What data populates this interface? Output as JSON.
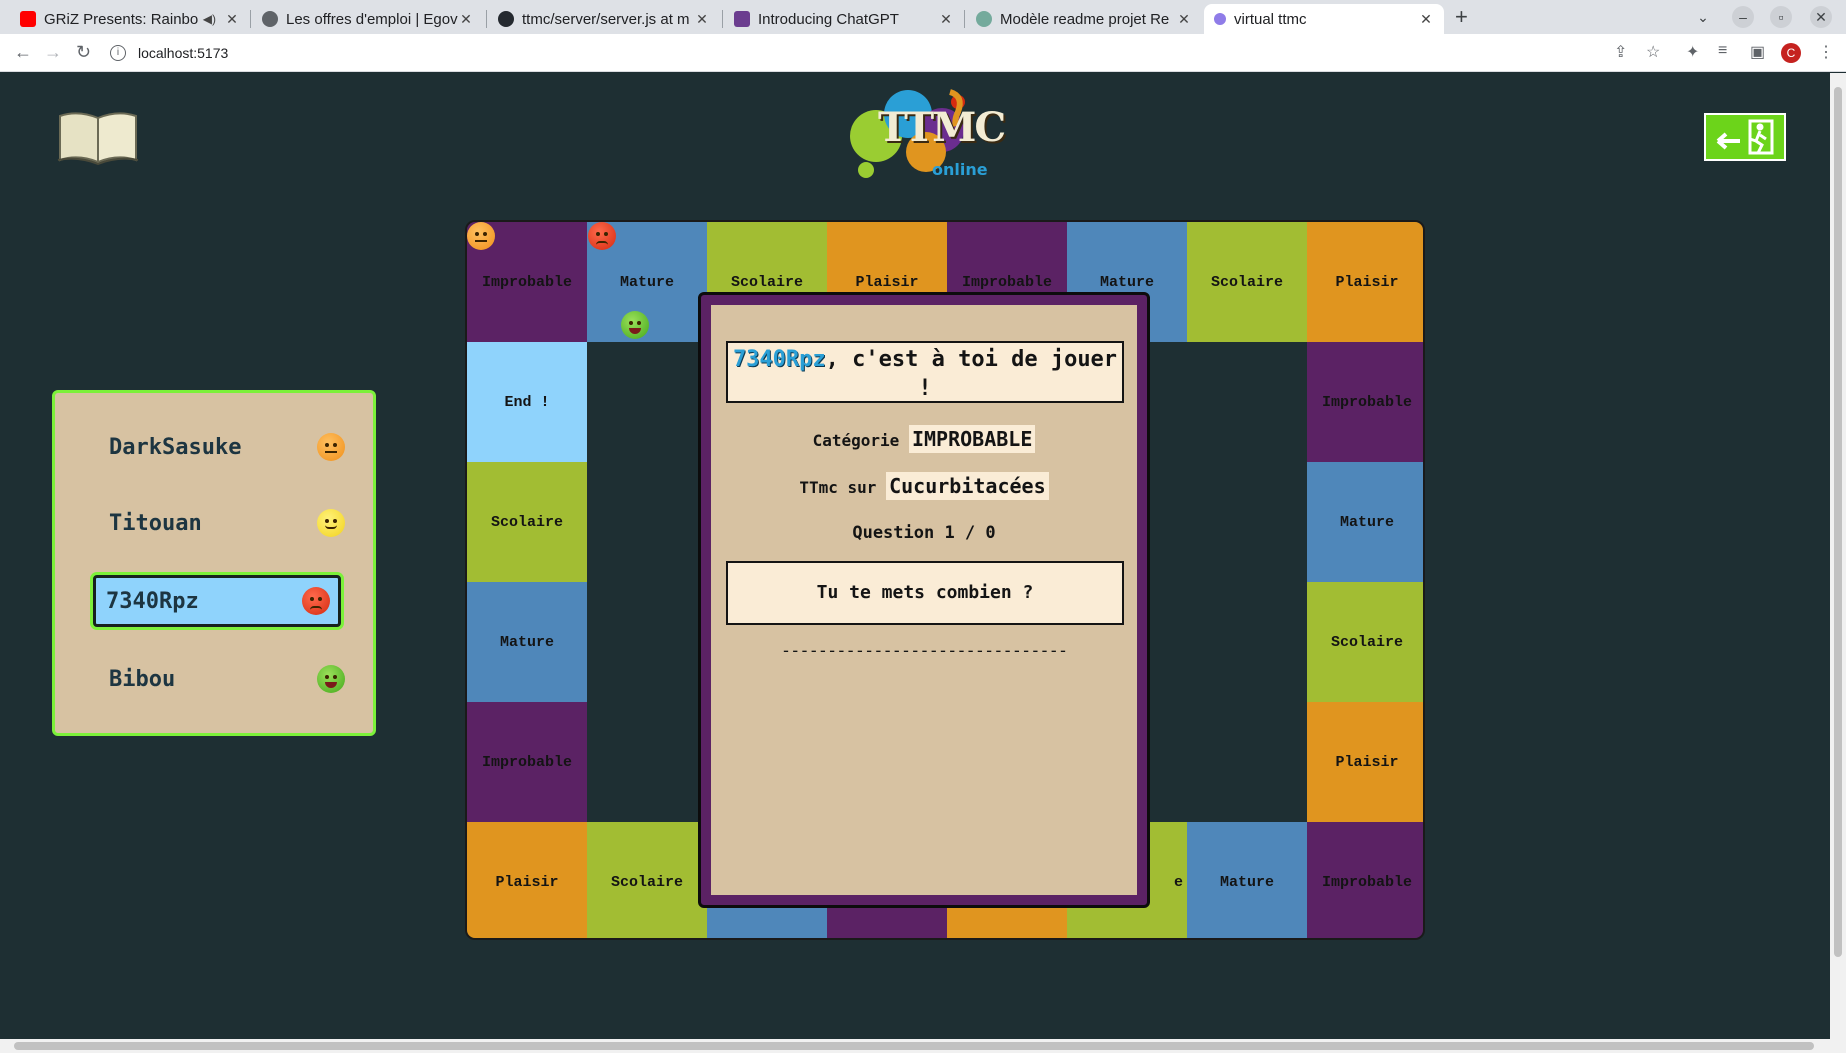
{
  "browser": {
    "tabs": [
      {
        "title": "GRiZ Presents: Rainbo",
        "favicon": "youtube-icon"
      },
      {
        "title": "Les offres d'emploi | Egov",
        "favicon": "globe-icon"
      },
      {
        "title": "ttmc/server/server.js at m",
        "favicon": "github-icon"
      },
      {
        "title": "Introducing ChatGPT",
        "favicon": "openai-icon"
      },
      {
        "title": "Modèle readme projet Re",
        "favicon": "chatgpt-icon"
      },
      {
        "title": "virtual ttmc",
        "favicon": "vite-icon"
      }
    ],
    "url": "localhost:5173",
    "profile_initial": "C"
  },
  "logo": {
    "main": "TTMC",
    "sub": "online"
  },
  "players": [
    {
      "name": "DarkSasuke",
      "face": "neutral-orange",
      "current": false
    },
    {
      "name": "Titouan",
      "face": "smile-yellow",
      "current": false
    },
    {
      "name": "7340Rpz",
      "face": "angry-red",
      "current": true
    },
    {
      "name": "Bibou",
      "face": "tongue-green",
      "current": false
    }
  ],
  "board": {
    "top_row": [
      "Improbable",
      "Mature",
      "Scolaire",
      "Plaisir",
      "Improbable",
      "Mature",
      "Scolaire",
      "Plaisir"
    ],
    "left_col": [
      "End !",
      "Scolaire",
      "Mature",
      "Improbable"
    ],
    "right_col": [
      "Improbable",
      "Mature",
      "Scolaire",
      "Plaisir"
    ],
    "bottom_row": [
      "Plaisir",
      "Scolaire",
      "",
      "",
      "",
      "e",
      "Mature",
      "Improbable"
    ]
  },
  "modal": {
    "current_player": "7340Rpz",
    "turn_text": ", c'est à toi de jouer !",
    "category_label": "Catégorie",
    "category_value": "IMPROBABLE",
    "topic_label": "TTmc sur",
    "topic_value": "Cucurbitacées",
    "question_counter": "Question 1 / 0",
    "question": "Tu te mets combien ?",
    "answer_placeholder": "-------------------------------"
  },
  "colors": {
    "background": "#1e2f33",
    "improbable": "#5b2264",
    "mature": "#4f87ba",
    "scolaire": "#a2bd33",
    "plaisir": "#e0951f",
    "end": "#8fd3fc",
    "panel": "#d7c2a2",
    "highlight": "#7cf13a"
  }
}
